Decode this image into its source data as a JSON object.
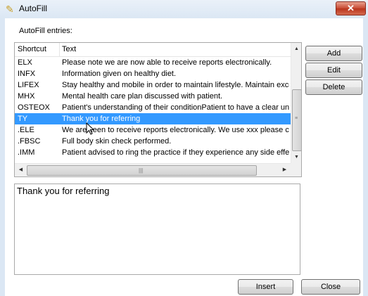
{
  "window": {
    "title": "AutoFill",
    "close_glyph": "✕"
  },
  "section_label": "AutoFill entries:",
  "list": {
    "columns": [
      "Shortcut",
      "Text"
    ],
    "rows": [
      {
        "shortcut": "ELX",
        "text": "Please note we are now able to receive reports electronically."
      },
      {
        "shortcut": "INFX",
        "text": "Information given on healthy diet."
      },
      {
        "shortcut": "LIFEX",
        "text": "Stay healthy and mobile in order to maintain lifestyle.  Maintain excelle"
      },
      {
        "shortcut": "MHX",
        "text": "Mental health care plan discussed with patient."
      },
      {
        "shortcut": "OSTEOX",
        "text": "Patient's understanding of their conditionPatient to have a clear under"
      },
      {
        "shortcut": "TY",
        "text": "Thank you for referring"
      },
      {
        "shortcut": ".ELE",
        "text": "We are keen to receive reports electronically. We use xxx please cor"
      },
      {
        "shortcut": ".FBSC",
        "text": "Full body skin check performed."
      },
      {
        "shortcut": ".IMM",
        "text": "Patient advised to ring the practice if they experience any side effects"
      }
    ],
    "selected_index": 5
  },
  "buttons": {
    "add": "Add",
    "edit": "Edit",
    "delete": "Delete",
    "insert": "Insert",
    "close": "Close"
  },
  "preview_text": "Thank you for referring",
  "icons": {
    "title": "pen-icon",
    "close": "close-icon"
  },
  "colors": {
    "selection": "#3399ff",
    "titlebar": "#dbe7f4",
    "close_button": "#c74a32"
  }
}
